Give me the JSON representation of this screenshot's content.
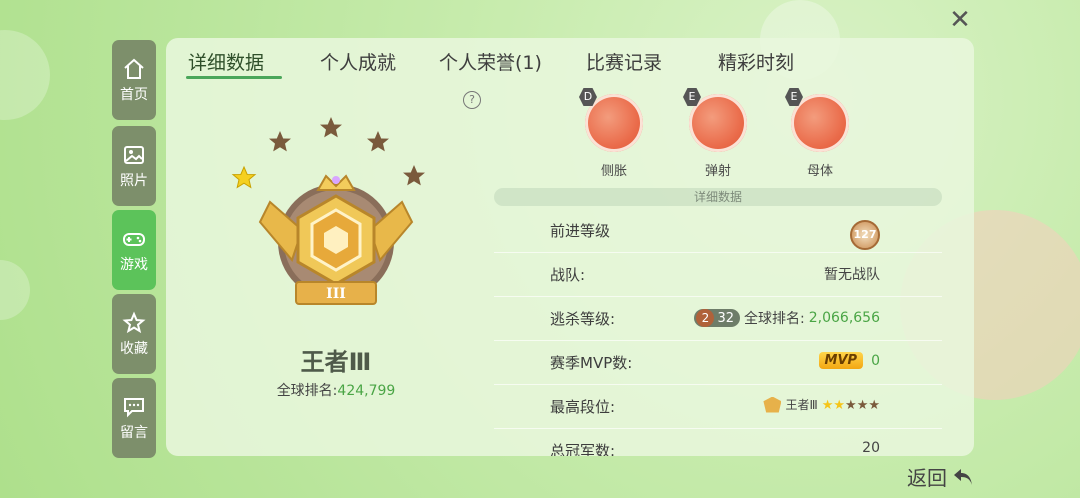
{
  "tabs": [
    {
      "label": "详细数据",
      "active": true
    },
    {
      "label": "个人成就"
    },
    {
      "label": "个人荣誉(1)"
    },
    {
      "label": "比赛记录"
    },
    {
      "label": "精彩时刻"
    }
  ],
  "sidebar": {
    "items": [
      {
        "label": "首页",
        "icon": "home-icon"
      },
      {
        "label": "照片",
        "icon": "photo-icon"
      },
      {
        "label": "游戏",
        "icon": "gamepad-icon",
        "active": true
      },
      {
        "label": "收藏",
        "icon": "star-icon"
      },
      {
        "label": "留言",
        "icon": "message-icon"
      }
    ]
  },
  "rank": {
    "name": "王者Ⅲ",
    "emblem_text": "III",
    "global_label": "全球排名:",
    "global_value": "424,799",
    "stars_total": 5,
    "stars_lit": 1
  },
  "help_icon": "?",
  "skills": [
    {
      "name": "侧胀",
      "tier": "D"
    },
    {
      "name": "弹射",
      "tier": "E"
    },
    {
      "name": "母体",
      "tier": "E"
    }
  ],
  "details": {
    "section_title": "详细数据",
    "rows": [
      {
        "label": "前进等级",
        "value": "127"
      },
      {
        "label": "战队:",
        "value": "暂无战队"
      },
      {
        "label": "逃杀等级:",
        "badge": "2",
        "level": "32",
        "rank_label": "全球排名:",
        "rank_value": "2,066,656"
      },
      {
        "label": "赛季MVP数:",
        "badge": "MVP",
        "value": "0"
      },
      {
        "label": "最高段位:",
        "value": "王者Ⅲ",
        "stars_lit": 2,
        "stars_total": 5
      },
      {
        "label": "总冠军数:",
        "value": "20"
      }
    ]
  },
  "back_label": "返回",
  "colors": {
    "accent": "#5cc35a",
    "sidebar": "#7d8f6b",
    "skill": "#ea6b4a",
    "value_green": "#4aa545"
  }
}
